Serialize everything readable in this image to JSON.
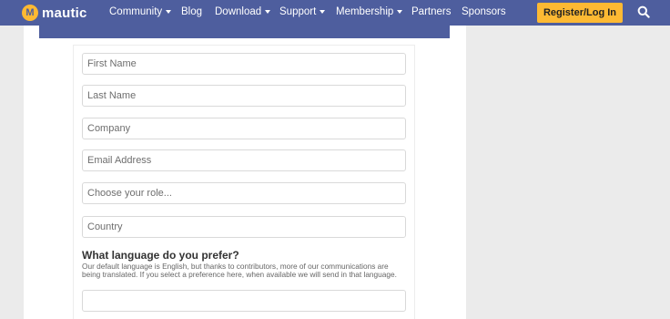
{
  "navbar": {
    "logo_text": "mautic",
    "items": [
      {
        "label": "Community",
        "has_dropdown": true
      },
      {
        "label": "Blog",
        "has_dropdown": false
      },
      {
        "label": "Download",
        "has_dropdown": true
      },
      {
        "label": "Support",
        "has_dropdown": true
      },
      {
        "label": "Membership",
        "has_dropdown": true
      },
      {
        "label": "Partners",
        "has_dropdown": false
      },
      {
        "label": "Sponsors",
        "has_dropdown": false
      }
    ],
    "register_label": "Register/Log In",
    "search_icon": "search-icon"
  },
  "colors": {
    "navbar": "#4e5e9e",
    "accent": "#fdb933",
    "side_background": "#ebebeb"
  },
  "form": {
    "fields": [
      {
        "placeholder": "First Name",
        "value": ""
      },
      {
        "placeholder": "Last Name",
        "value": ""
      },
      {
        "placeholder": "Company",
        "value": ""
      },
      {
        "placeholder": "Email Address",
        "value": ""
      },
      {
        "placeholder": "Choose your role...",
        "value": ""
      },
      {
        "placeholder": "Country",
        "value": ""
      }
    ],
    "language_question": "What language do you prefer?",
    "language_help": "Our default language is English, but thanks to contributors, more of our communications are being translated. If you select a preference here, when available we will send in that language.",
    "language_value": ""
  }
}
